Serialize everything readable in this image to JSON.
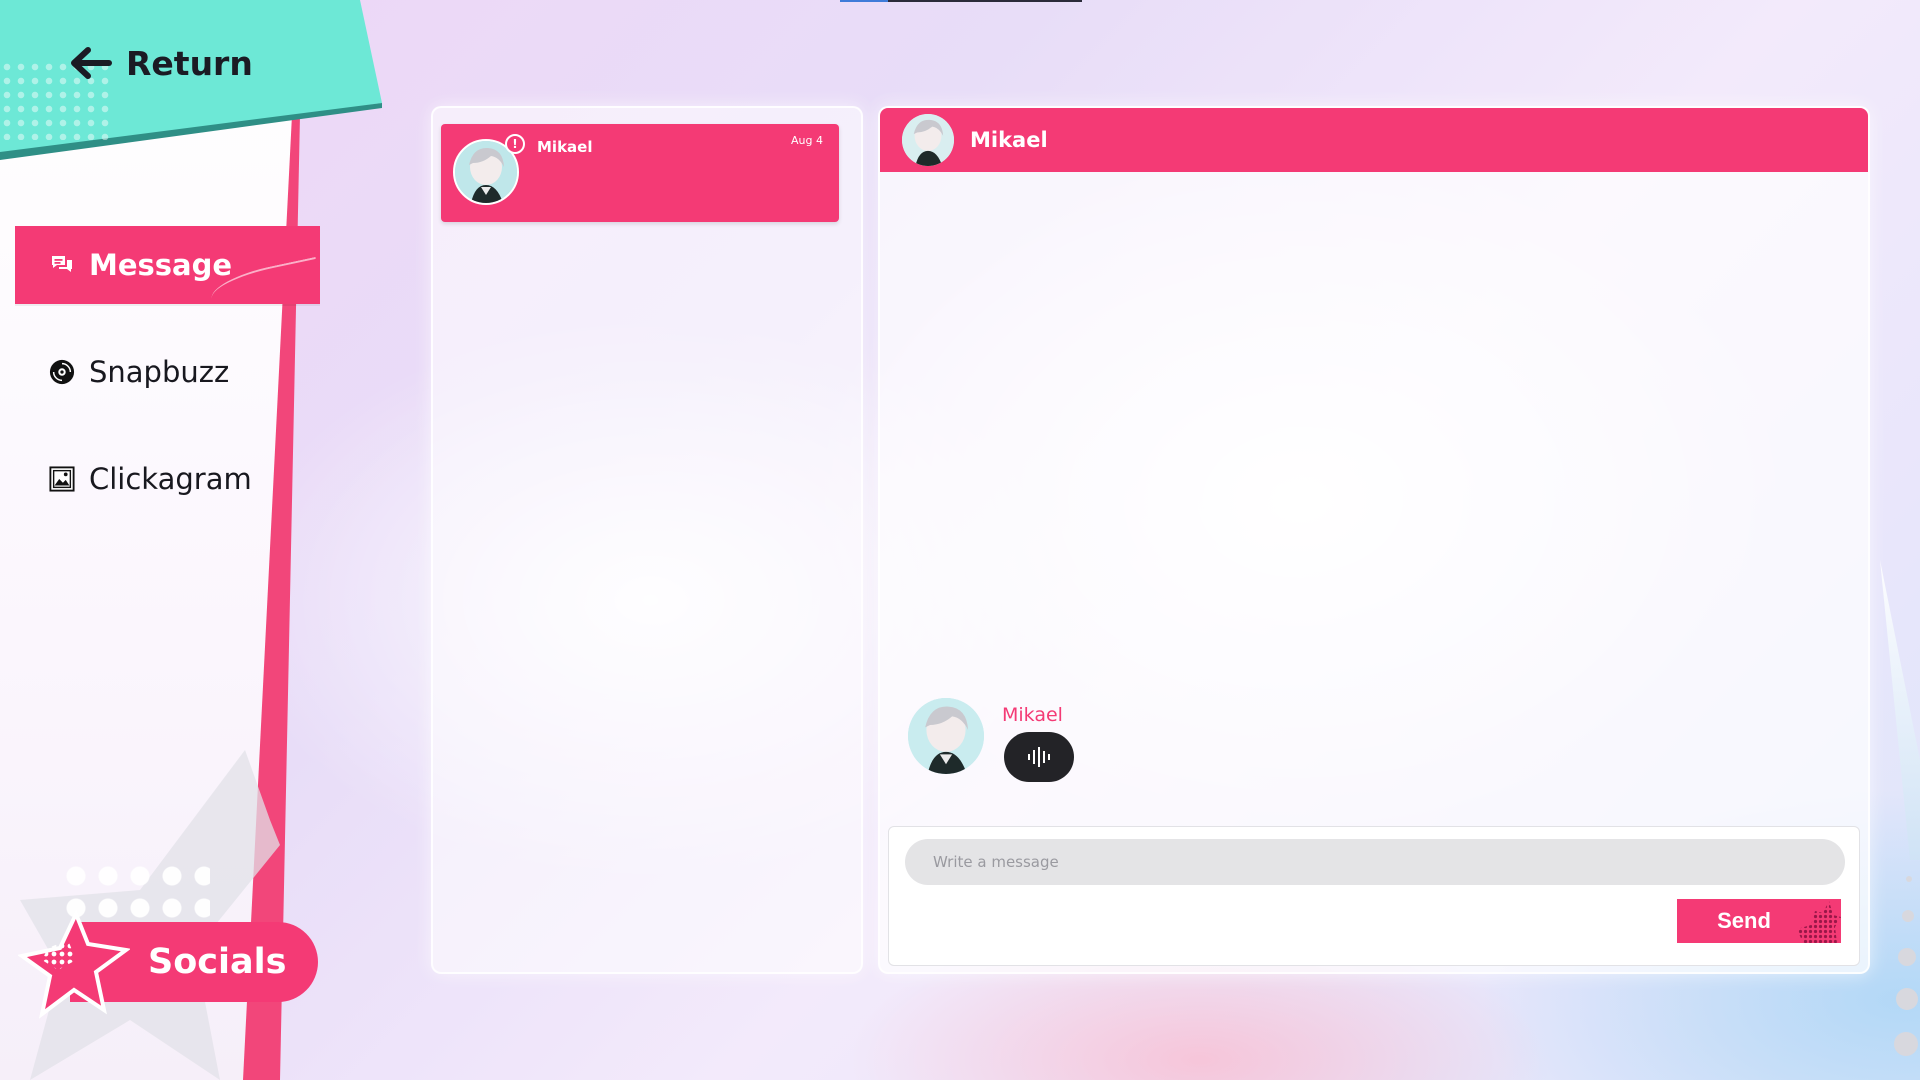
{
  "nav": {
    "return_label": "Return",
    "items": [
      {
        "label": "Message",
        "icon": "message-icon",
        "active": true
      },
      {
        "label": "Snapbuzz",
        "icon": "disc-icon",
        "active": false
      },
      {
        "label": "Clickagram",
        "icon": "image-icon",
        "active": false
      }
    ],
    "section_label": "Socials"
  },
  "contacts": [
    {
      "name": "Mikael",
      "date": "Aug 4",
      "unread_badge": "!"
    }
  ],
  "chat": {
    "header_name": "Mikael",
    "messages": [
      {
        "sender": "Mikael",
        "type": "voice"
      }
    ],
    "compose": {
      "placeholder": "Write a message",
      "send_label": "Send"
    }
  },
  "colors": {
    "accent": "#f43a75",
    "return_banner": "#6de8d6",
    "voice_bubble": "#232327"
  }
}
